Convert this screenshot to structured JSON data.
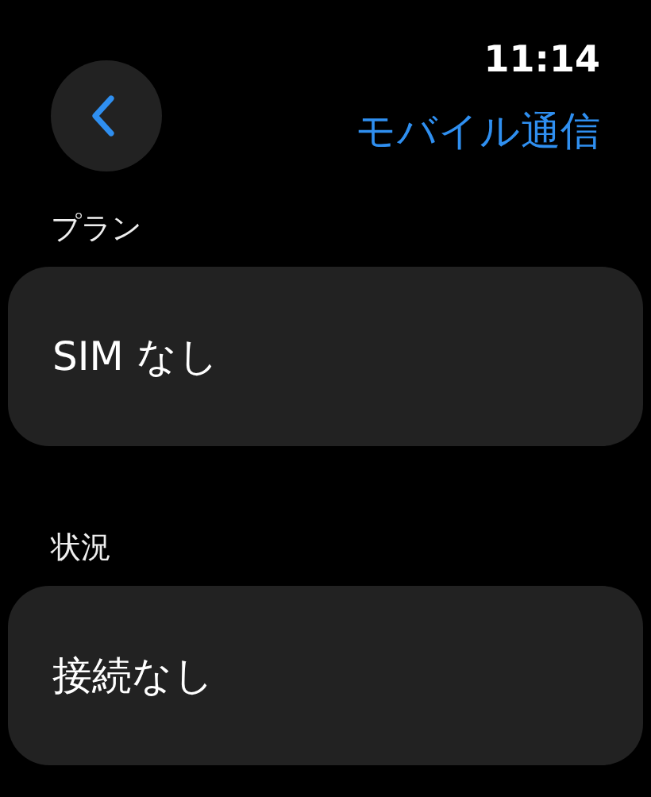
{
  "status_bar": {
    "time": "11:14"
  },
  "nav": {
    "title": "モバイル通信"
  },
  "sections": [
    {
      "header": "プラン",
      "value": "SIM なし"
    },
    {
      "header": "状況",
      "value": "接続なし"
    }
  ]
}
